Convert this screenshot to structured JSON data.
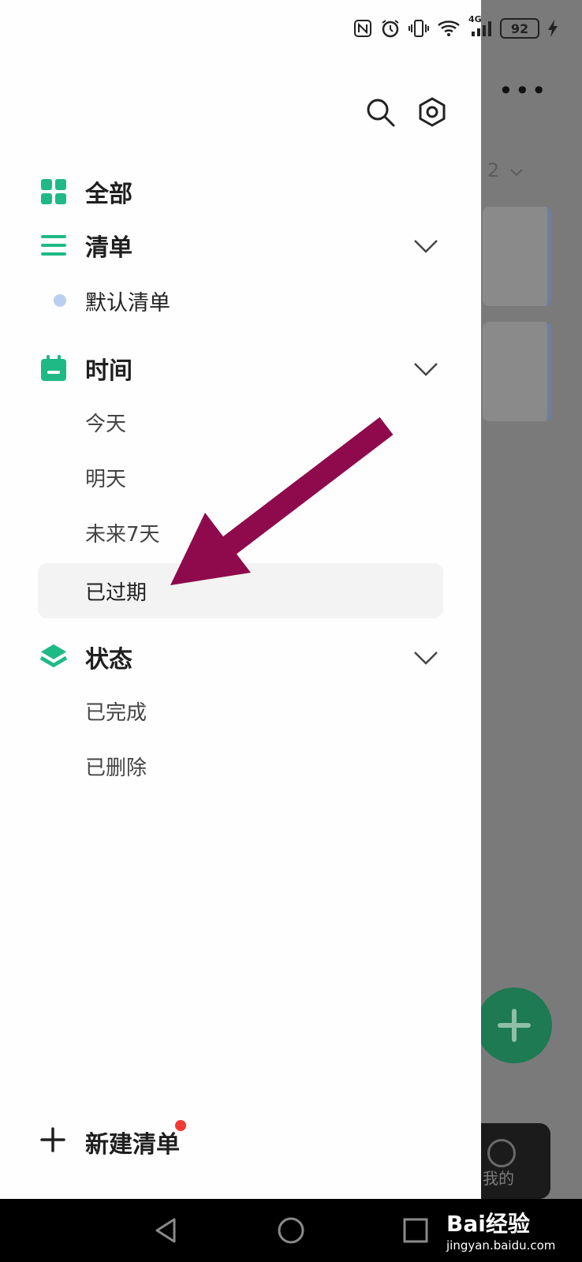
{
  "status_bar": {
    "battery": "92",
    "network": "4G",
    "icons": [
      "nfc-icon",
      "alarm-icon",
      "vibrate-icon",
      "wifi-icon",
      "signal-icon",
      "battery-icon",
      "charging-icon"
    ]
  },
  "drawer": {
    "header_icons": [
      "search-icon",
      "settings-icon"
    ],
    "sections": {
      "all": {
        "label": "全部"
      },
      "lists": {
        "label": "清单",
        "items": [
          {
            "label": "默认清单"
          }
        ]
      },
      "time": {
        "label": "时间",
        "items": [
          {
            "label": "今天"
          },
          {
            "label": "明天"
          },
          {
            "label": "未来7天"
          },
          {
            "label": "已过期"
          }
        ]
      },
      "status": {
        "label": "状态",
        "items": [
          {
            "label": "已完成"
          },
          {
            "label": "已删除"
          }
        ]
      }
    },
    "selected_item": "已过期",
    "new_list_label": "新建清单",
    "accent_color": "#1fb985"
  },
  "background_app": {
    "count": "2",
    "tab_label": "我的"
  },
  "annotation": {
    "arrow_color": "#8e0a4c"
  },
  "watermark": {
    "brand": "Bai经验",
    "url": "jingyan.baidu.com"
  }
}
